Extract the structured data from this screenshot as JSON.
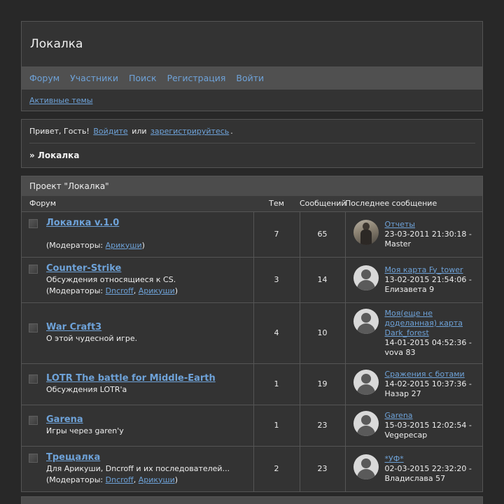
{
  "site": {
    "title": "Локалка"
  },
  "nav": [
    {
      "label": "Форум"
    },
    {
      "label": "Участники"
    },
    {
      "label": "Поиск"
    },
    {
      "label": "Регистрация"
    },
    {
      "label": "Войти"
    }
  ],
  "subnav": {
    "active_topics": "Активные темы"
  },
  "welcome": {
    "greeting": "Привет, Гость!",
    "login_link": "Войдите",
    "or": "или",
    "register_link": "зарегистрируйтесь",
    "period": ".",
    "breadcrumb": "» Локалка"
  },
  "category": {
    "title": "Проект \"Локалка\"",
    "columns": {
      "forum": "Форум",
      "topics": "Тем",
      "posts": "Сообщений",
      "last_post": "Последнее сообщение"
    },
    "moderators_label": "(Модераторы: ",
    "forums": [
      {
        "title": "Локалка v.1.0",
        "description": "",
        "moderators": [
          "Арикуши"
        ],
        "topics": "7",
        "posts": "65",
        "last_topic": "Отчеты",
        "last_when": "23-03-2011 21:30:18 - Master",
        "avatar": "photo"
      },
      {
        "title": "Counter-Strike",
        "description": "Обсуждения относящиеся к CS.",
        "moderators": [
          "Dncroff",
          "Арикуши"
        ],
        "topics": "3",
        "posts": "14",
        "last_topic": "Моя карта Fy_tower",
        "last_when": "13-02-2015 21:54:06 - Елизавета 9",
        "avatar": "default"
      },
      {
        "title": "War Craft3",
        "description": "О этой чудесной игре.",
        "moderators": [],
        "topics": "4",
        "posts": "10",
        "last_topic": "Моя(еще не доделанная) карта Dark_forest",
        "last_when": "14-01-2015 04:52:36 - vova 83",
        "avatar": "default"
      },
      {
        "title": "LOTR The battle for Middle-Earth",
        "description": "Обсуждения LOTR'а",
        "moderators": [],
        "topics": "1",
        "posts": "19",
        "last_topic": "Сражения с ботами",
        "last_when": "14-02-2015 10:37:36 - Назар 27",
        "avatar": "default"
      },
      {
        "title": "Garena",
        "description": "Игры через garen'у",
        "moderators": [],
        "topics": "1",
        "posts": "23",
        "last_topic": "Garena",
        "last_when": "15-03-2015 12:02:54 - Vegepecap",
        "avatar": "default"
      },
      {
        "title": "Трещалка",
        "description": "Для Арикуши, Dncroff и их последователей...",
        "moderators": [
          "Dncroff",
          "Арикуши"
        ],
        "topics": "2",
        "posts": "23",
        "last_topic": "*УФ*",
        "last_when": "02-03-2015 22:32:20 - Владислава 57",
        "avatar": "default"
      }
    ]
  },
  "colors": {
    "background": "#282828",
    "panel": "#333333",
    "bar": "#505050",
    "link": "#6ea2d8"
  }
}
